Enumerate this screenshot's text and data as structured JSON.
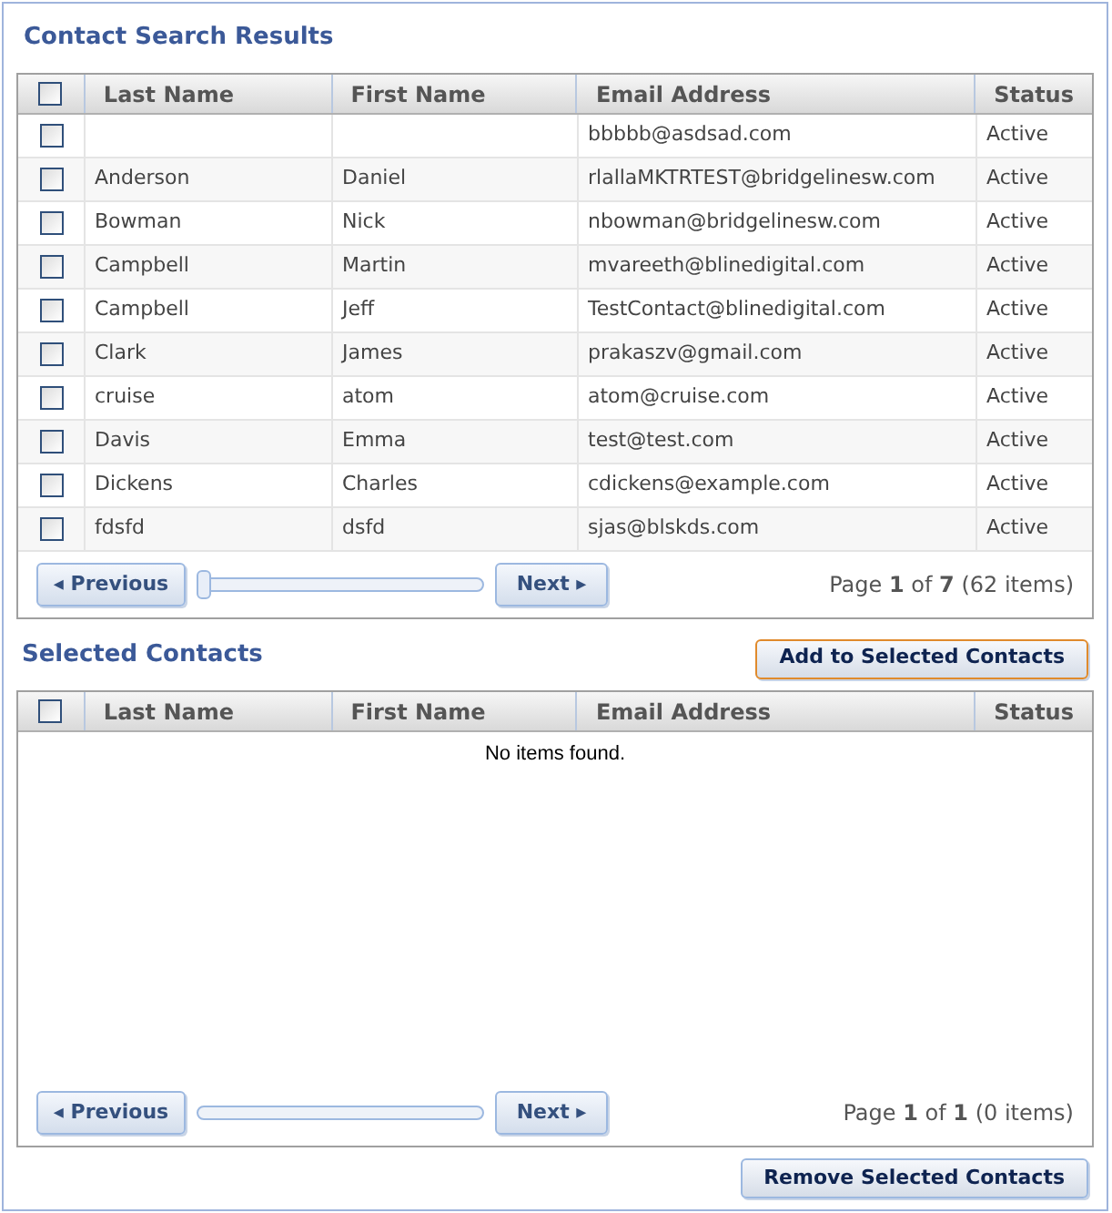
{
  "search_results": {
    "title": "Contact Search Results",
    "columns": [
      {
        "label": "Last Name"
      },
      {
        "label": "First Name"
      },
      {
        "label": "Email Address"
      },
      {
        "label": "Status"
      }
    ],
    "select_all_checked": false,
    "rows": [
      {
        "checked": false,
        "last": "",
        "first": "",
        "email": "bbbbb@asdsad.com",
        "status": "Active"
      },
      {
        "checked": false,
        "last": "Anderson",
        "first": "Daniel",
        "email": "rlallaMKTRTEST@bridgelinesw.com",
        "status": "Active"
      },
      {
        "checked": false,
        "last": "Bowman",
        "first": "Nick",
        "email": "nbowman@bridgelinesw.com",
        "status": "Active"
      },
      {
        "checked": false,
        "last": "Campbell",
        "first": "Martin",
        "email": "mvareeth@blinedigital.com",
        "status": "Active"
      },
      {
        "checked": false,
        "last": "Campbell",
        "first": "Jeff",
        "email": "TestContact@blinedigital.com",
        "status": "Active"
      },
      {
        "checked": false,
        "last": "Clark",
        "first": "James",
        "email": "prakaszv@gmail.com",
        "status": "Active"
      },
      {
        "checked": false,
        "last": "cruise",
        "first": "atom",
        "email": "atom@cruise.com",
        "status": "Active"
      },
      {
        "checked": false,
        "last": "Davis",
        "first": "Emma",
        "email": "test@test.com",
        "status": "Active"
      },
      {
        "checked": false,
        "last": "Dickens",
        "first": "Charles",
        "email": "cdickens@example.com",
        "status": "Active"
      },
      {
        "checked": false,
        "last": "fdsfd",
        "first": "dsfd",
        "email": "sjas@blskds.com",
        "status": "Active"
      }
    ],
    "pager": {
      "previous": "◂ Previous",
      "next": "Next ▸",
      "level": 0,
      "info": "Page **1** of **7** (62 items)"
    }
  },
  "add_button": {
    "label": "Add to Selected Contacts",
    "focused": true
  },
  "selected": {
    "title": "Selected Contacts",
    "columns": [
      {
        "label": "Last Name"
      },
      {
        "label": "First Name"
      },
      {
        "label": "Email Address"
      },
      {
        "label": "Status"
      }
    ],
    "select_all_checked": false,
    "empty_text": "No items found.",
    "pager": {
      "previous": "◂ Previous",
      "next": "Next ▸",
      "info": "Page **1** of **1** (0 items)"
    }
  },
  "remove_button": {
    "label": "Remove Selected Contacts",
    "focused": false
  }
}
